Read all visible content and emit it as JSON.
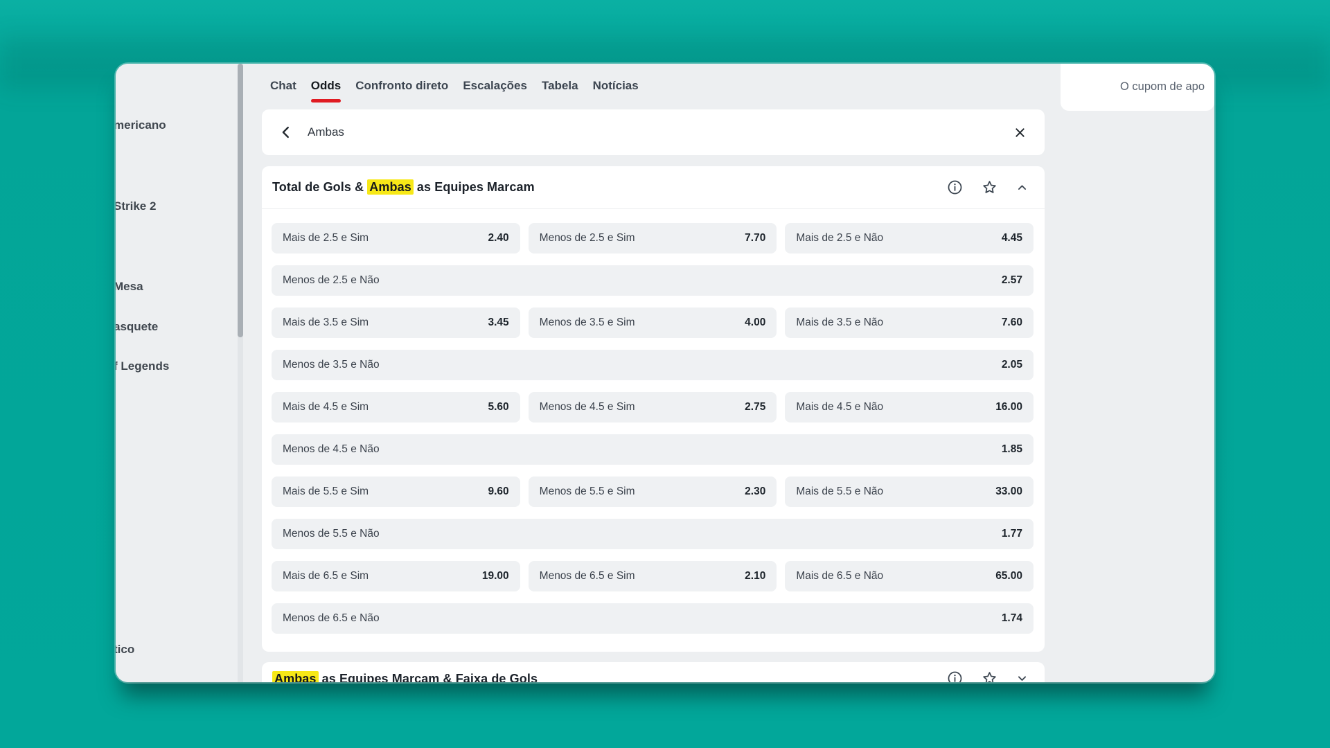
{
  "colors": {
    "background_teal": "#02a79a",
    "accent_red": "#e01b22",
    "highlight_yellow": "#f7e817",
    "window_bg": "#edeff1",
    "card_bg": "#ffffff",
    "odd_button_bg": "#eff1f3",
    "icon_color": "#39434e"
  },
  "sidebar": {
    "items": [
      {
        "label": "mericano"
      },
      {
        "label": "Strike 2"
      },
      {
        "label": "Mesa"
      },
      {
        "label": "asquete"
      },
      {
        "label": "f Legends"
      },
      {
        "label": "tico"
      }
    ]
  },
  "tabs": [
    {
      "label": "Chat"
    },
    {
      "label": "Odds"
    },
    {
      "label": "Confronto direto"
    },
    {
      "label": "Escalações"
    },
    {
      "label": "Tabela"
    },
    {
      "label": "Notícias"
    }
  ],
  "active_tab": "Odds",
  "search": {
    "query": "Ambas",
    "back_icon": "chevron-left",
    "close_icon": "x"
  },
  "coupon": {
    "text": "O cupom de apo"
  },
  "markets": [
    {
      "title": {
        "before": "Total de Gols & ",
        "highlight": "Ambas",
        "after": " as Equipes Marcam"
      },
      "icons": [
        "info",
        "star",
        "collapse"
      ],
      "rows": [
        {
          "cells": [
            {
              "label": "Mais de 2.5 e Sim",
              "odds": "2.40"
            },
            {
              "label": "Menos de 2.5 e Sim",
              "odds": "7.70"
            },
            {
              "label": "Mais de 2.5 e Não",
              "odds": "4.45"
            }
          ]
        },
        {
          "cells": [
            {
              "label": "Menos de 2.5 e Não",
              "odds": "2.57"
            }
          ]
        },
        {
          "cells": [
            {
              "label": "Mais de 3.5 e Sim",
              "odds": "3.45"
            },
            {
              "label": "Menos de 3.5 e Sim",
              "odds": "4.00"
            },
            {
              "label": "Mais de 3.5 e Não",
              "odds": "7.60"
            }
          ]
        },
        {
          "cells": [
            {
              "label": "Menos de 3.5 e Não",
              "odds": "2.05"
            }
          ]
        },
        {
          "cells": [
            {
              "label": "Mais de 4.5 e Sim",
              "odds": "5.60"
            },
            {
              "label": "Menos de 4.5 e Sim",
              "odds": "2.75"
            },
            {
              "label": "Mais de 4.5 e Não",
              "odds": "16.00"
            }
          ]
        },
        {
          "cells": [
            {
              "label": "Menos de 4.5 e Não",
              "odds": "1.85"
            }
          ]
        },
        {
          "cells": [
            {
              "label": "Mais de 5.5 e Sim",
              "odds": "9.60"
            },
            {
              "label": "Menos de 5.5 e Sim",
              "odds": "2.30"
            },
            {
              "label": "Mais de 5.5 e Não",
              "odds": "33.00"
            }
          ]
        },
        {
          "cells": [
            {
              "label": "Menos de 5.5 e Não",
              "odds": "1.77"
            }
          ]
        },
        {
          "cells": [
            {
              "label": "Mais de 6.5 e Sim",
              "odds": "19.00"
            },
            {
              "label": "Menos de 6.5 e Sim",
              "odds": "2.10"
            },
            {
              "label": "Mais de 6.5 e Não",
              "odds": "65.00"
            }
          ]
        },
        {
          "cells": [
            {
              "label": "Menos de 6.5 e Não",
              "odds": "1.74"
            }
          ]
        }
      ]
    },
    {
      "title": {
        "before": "",
        "highlight": "Ambas",
        "after": " as Equipes Marcam & Faixa de Gols"
      },
      "icons": [
        "info",
        "star",
        "expand"
      ]
    }
  ]
}
